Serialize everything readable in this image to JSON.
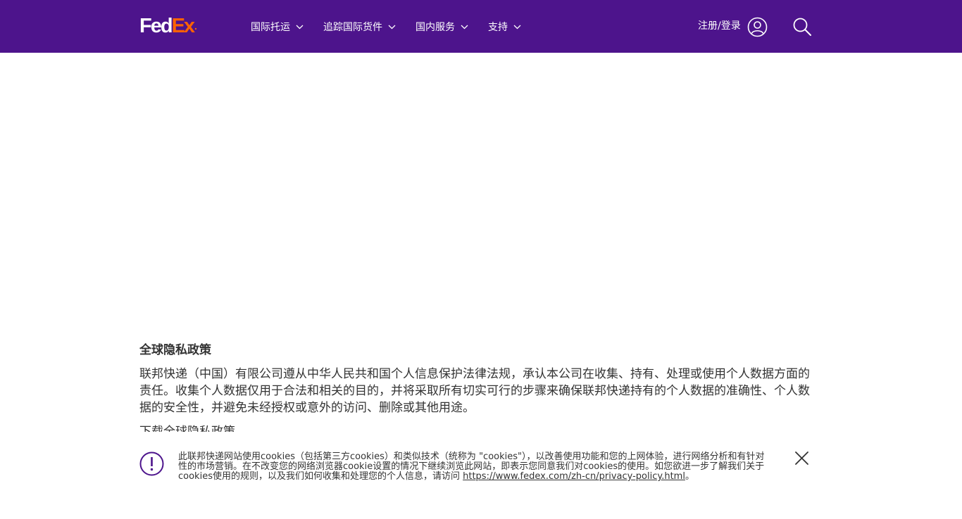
{
  "header": {
    "logo": {
      "fed": "Fed",
      "ex": "Ex",
      "dot": "."
    },
    "nav": [
      {
        "label": "国际托运"
      },
      {
        "label": "追踪国际货件"
      },
      {
        "label": "国内服务"
      },
      {
        "label": "支持"
      }
    ],
    "login_label": "注册/登录",
    "icons": {
      "user": "user-icon",
      "search": "search-icon",
      "chevron": "chevron-down-icon"
    },
    "background_color": "#4d148c",
    "accent_color": "#ff6200"
  },
  "main": {
    "title": "全球隐私政策",
    "paragraph": "联邦快递（中国）有限公司遵从中华人民共和国个人信息保护法律法规，承认本公司在收集、持有、处理或使用个人数据方面的责任。收集个人数据仅用于合法和相关的目的，并将采取所有切实可行的步骤来确保联邦快递持有的个人数据的准确性、个人数据的安全性，并避免未经授权或意外的访问、删除或其他用途。",
    "download_link": "下载全球隐私政策"
  },
  "cookie_banner": {
    "text": "此联邦快递网站使用cookies（包括第三方cookies）和类似技术（统称为 \"cookies\"），以改善使用功能和您的上网体验，进行网络分析和有针对性的市场营销。在不改变您的网络浏览器cookie设置的情况下继续浏览此网站，即表示您同意我们对cookies的使用。如您欲进一步了解我们关于cookies使用的规则，以及我们如何收集和处理您的个人信息，请访问 ",
    "link": "https://www.fedex.com/zh-cn/privacy-policy.html",
    "end": "。",
    "icons": {
      "alert": "alert-icon",
      "close": "close-icon"
    }
  }
}
